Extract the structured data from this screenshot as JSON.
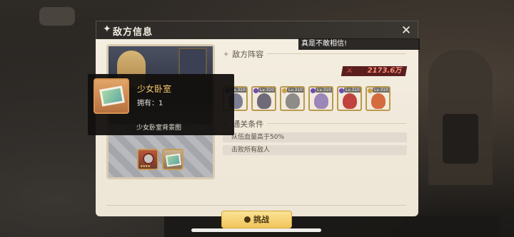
{
  "modal": {
    "title": "敌方信息",
    "close_icon": "close-x-icon"
  },
  "enemy_section": {
    "label": "敌方阵容",
    "power_value": "2173.6万"
  },
  "banner": {
    "text": "真是不敢相信!",
    "green_text": ""
  },
  "heroes": [
    {
      "level": "Lv.310",
      "color": "#7c7f92"
    },
    {
      "level": "Lv.310",
      "color": "#6e6a78"
    },
    {
      "level": "Lv.310",
      "color": "#8e8c88"
    },
    {
      "level": "Lv.310",
      "color": "#9d86b8"
    },
    {
      "level": "Lv.310",
      "color": "#c0433f"
    },
    {
      "level": "Lv.310",
      "color": "#d46b3f"
    }
  ],
  "conditions_section": {
    "label": "通关条件",
    "items": [
      "队伍血量高于50%",
      "击败所有敌人"
    ]
  },
  "rewards": [
    {
      "icon": "knight-helmet-icon"
    },
    {
      "icon": "photo-background-icon"
    }
  ],
  "challenge_button": {
    "label": "挑战"
  },
  "tooltip": {
    "name": "少女卧室",
    "owned": "拥有：1",
    "description": "少女卧室背景图"
  },
  "colors": {
    "panel": "#f1eadc",
    "title_bar": "#2d2a27",
    "button": "#f1c55a",
    "power": "#5b1e1e"
  }
}
